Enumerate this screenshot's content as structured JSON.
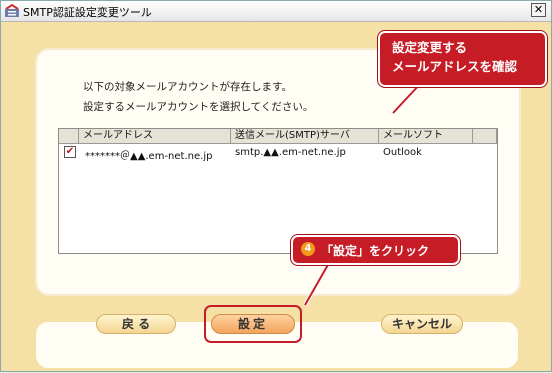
{
  "window": {
    "title": "SMTP認証設定変更ツール",
    "close_glyph": "✕"
  },
  "intro": {
    "line1": "以下の対象メールアカウントが存在します。",
    "line2": "設定するメールアカウントを選択してください。"
  },
  "table": {
    "columns": [
      "メールアドレス",
      "送信メール(SMTP)サーバ",
      "メールソフト"
    ],
    "rows": [
      {
        "checked": true,
        "check_glyph": "✔",
        "email": "*******＠▲▲.em-net.ne.jp",
        "server": "smtp.▲▲.em-net.ne.jp",
        "client": "Outlook"
      }
    ]
  },
  "buttons": {
    "back": "戻 る",
    "set": "設定",
    "cancel": "キャンセル"
  },
  "callouts": {
    "top_line1": "設定変更する",
    "top_line2": "メールアドレスを確認",
    "step_number": "4",
    "step_text": "「設定」をクリック"
  },
  "colors": {
    "callout_red": "#c51c26",
    "step_orange": "#f39a1a",
    "panel_bg": "#f5e0a6"
  },
  "icons": [
    "app-icon",
    "close-icon",
    "checkmark-icon"
  ]
}
